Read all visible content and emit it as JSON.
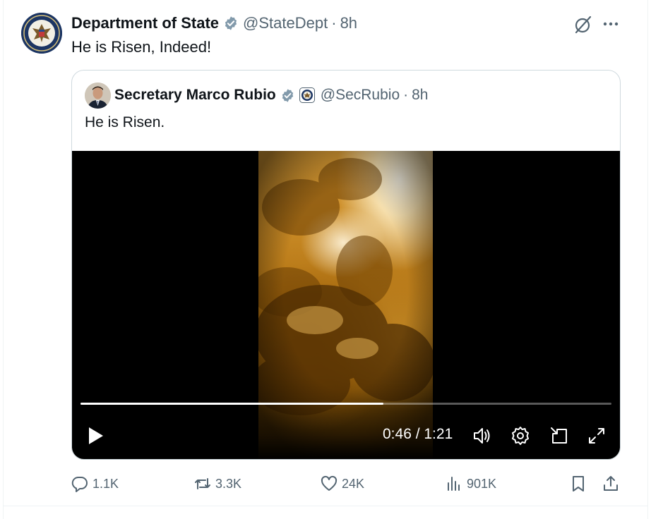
{
  "post": {
    "display_name": "Department of State",
    "handle": "@StateDept",
    "separator": "·",
    "time": "8h",
    "text": "He is Risen, Indeed!"
  },
  "quoted": {
    "display_name": "Secretary Marco Rubio",
    "handle": "@SecRubio",
    "separator": "·",
    "time": "8h",
    "text": "He is Risen."
  },
  "video": {
    "elapsed": "0:46",
    "duration": "1:21",
    "time_readout": "0:46 / 1:21",
    "progress_fraction": 0.57
  },
  "actions": {
    "replies": "1.1K",
    "reposts": "3.3K",
    "likes": "24K",
    "views": "901K"
  },
  "icons": {
    "verified": "verified-badge-icon",
    "grok": "grok-icon",
    "more": "more-icon",
    "reply": "reply-icon",
    "repost": "repost-icon",
    "like": "heart-icon",
    "views": "views-chart-icon",
    "bookmark": "bookmark-icon",
    "share": "share-icon"
  },
  "colors": {
    "text_primary": "#0f1419",
    "text_secondary": "#536471",
    "verified_gray": "#829aab",
    "border": "#cfd9de",
    "video_bg": "#000000"
  }
}
